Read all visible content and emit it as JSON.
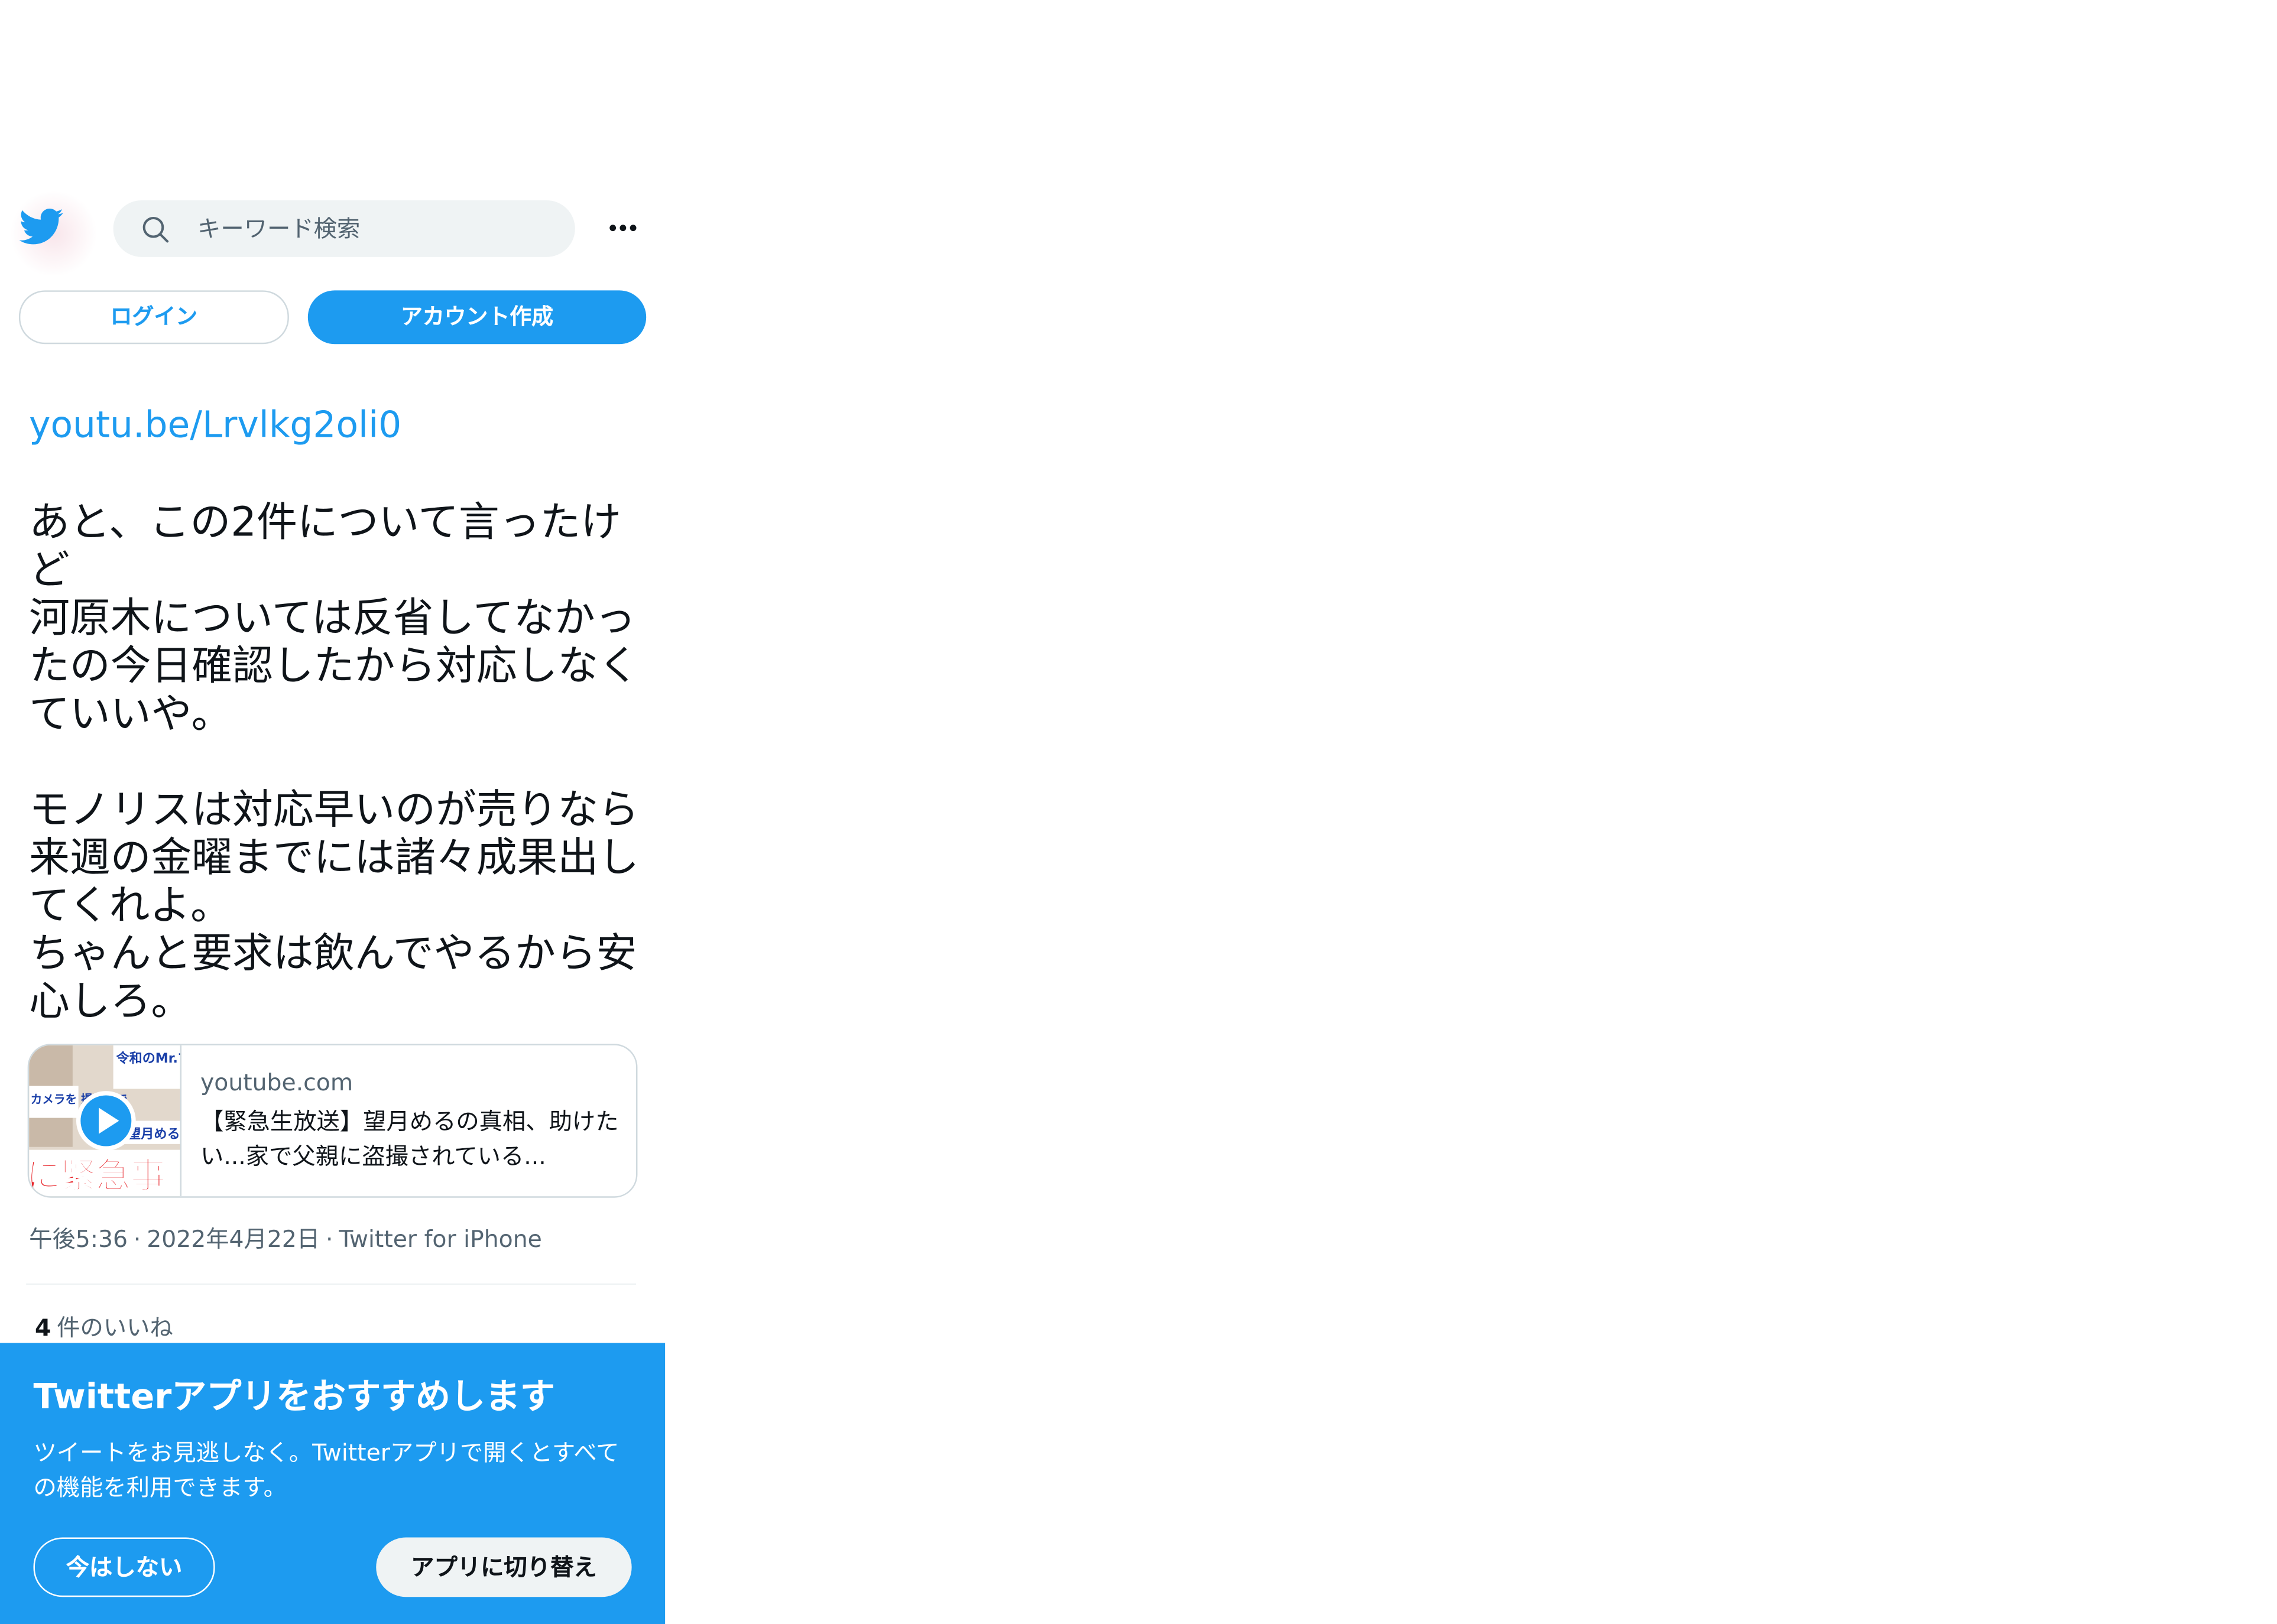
{
  "colors": {
    "brand": "#1d9bf0",
    "text_primary": "#0f1419",
    "text_secondary": "#536471",
    "border": "#cfd9de",
    "search_bg": "#eff3f4"
  },
  "header": {
    "logo_icon": "twitter-bird-icon",
    "search_icon": "search-icon",
    "search_placeholder": "キーワード検索",
    "more_icon": "more-horizontal-icon"
  },
  "auth": {
    "login_label": "ログイン",
    "signup_label": "アカウント作成"
  },
  "tweet": {
    "link_text": "youtu.be/Lrvlkg2oli0",
    "text": "あと、この2件について言ったけど\n河原木については反省してなかったの今日確認したから対応しなくていいや。\n\nモノリスは対応早いのが売りなら来週の金曜までには諸々成果出してくれよ。\nちゃんと要求は飲んでやるから安心しろ。"
  },
  "card": {
    "domain": "youtube.com",
    "title": "【緊急生放送】望月めるの真相、助けたい...家で父親に盗撮されている...",
    "thumbnail_icon": "play-icon",
    "thumbnail_text": {
      "top_right": "令和のMr.マ 詐欺あっさん",
      "left": "カメラを 撮通話で",
      "middle_right": "望月める",
      "bottom": "に緊急事"
    }
  },
  "meta": {
    "time": "午後5:36",
    "date": "2022年4月22日",
    "source": "Twitter for iPhone",
    "separator": "·"
  },
  "likes": {
    "count": "4",
    "label": "件のいいね"
  },
  "app_banner": {
    "title": "Twitterアプリをおすすめします",
    "description": "ツイートをお見逃しなく。Twitterアプリで開くとすべての機能を利用できます。",
    "not_now_label": "今はしない",
    "switch_label": "アプリに切り替え"
  }
}
